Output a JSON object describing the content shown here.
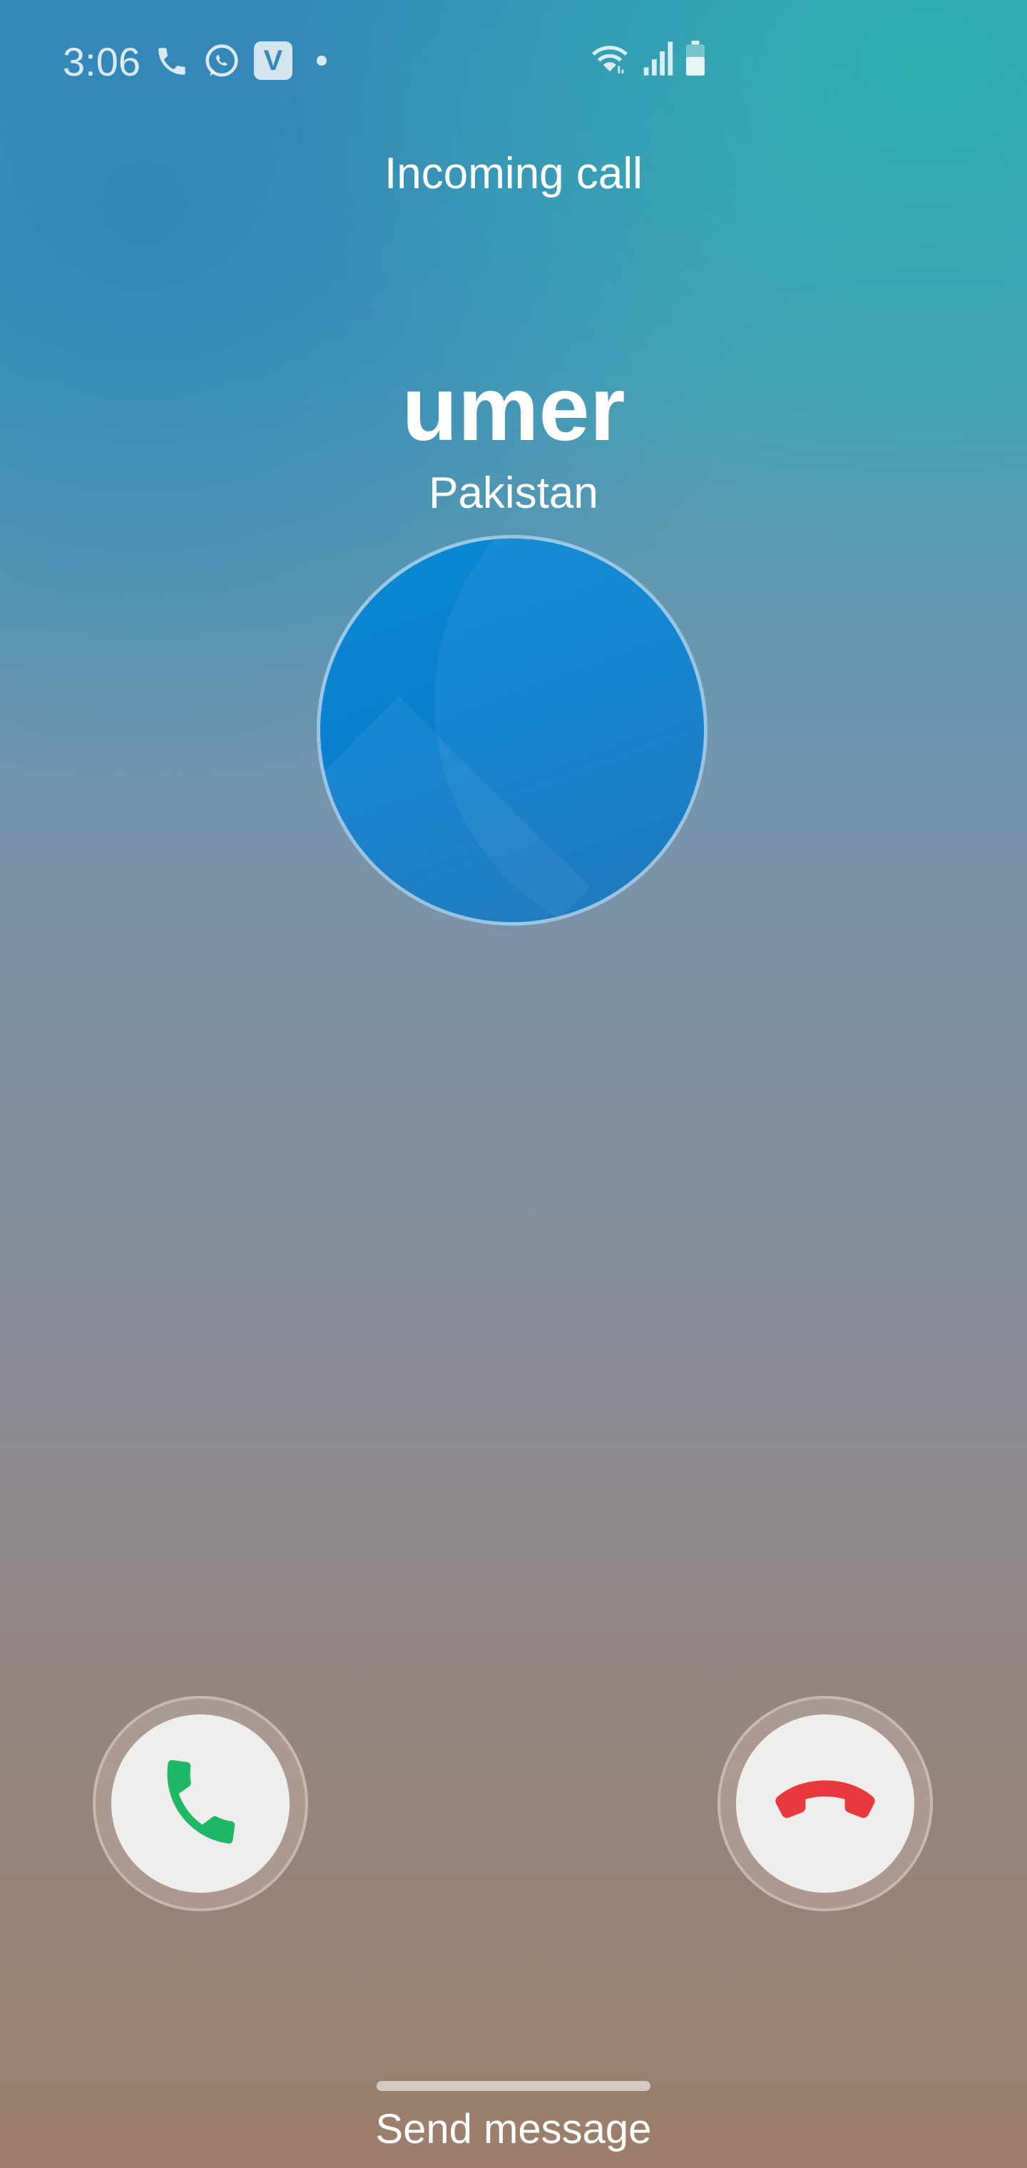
{
  "status_bar": {
    "time": "3:06",
    "icons": [
      "phone-icon",
      "whatsapp-icon",
      "v-app-icon",
      "notification-dot",
      "wifi-icon",
      "signal-icon",
      "battery-icon"
    ],
    "v_app_letter": "V"
  },
  "call": {
    "header": "Incoming call",
    "caller_name": "umer",
    "caller_location": "Pakistan"
  },
  "actions": {
    "accept_icon": "phone-accept-icon",
    "decline_icon": "phone-decline-icon",
    "send_message_label": "Send message"
  },
  "colors": {
    "accept": "#1fb866",
    "decline": "#e83a3e",
    "avatar": "#0a80cf",
    "button_face": "#efeeec"
  }
}
